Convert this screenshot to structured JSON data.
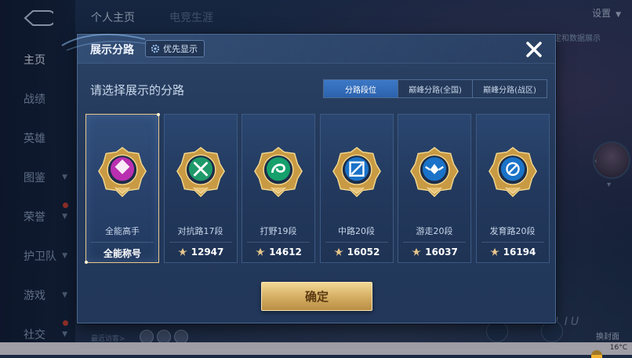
{
  "sidebar": {
    "items": [
      {
        "label": "主页",
        "active": true,
        "chevron": false,
        "dot": false
      },
      {
        "label": "战绩",
        "active": false,
        "chevron": false,
        "dot": false
      },
      {
        "label": "英雄",
        "active": false,
        "chevron": false,
        "dot": false
      },
      {
        "label": "图鉴",
        "active": false,
        "chevron": true,
        "dot": false
      },
      {
        "label": "荣誉",
        "active": false,
        "chevron": true,
        "dot": true
      },
      {
        "label": "护卫队",
        "active": false,
        "chevron": true,
        "dot": false
      },
      {
        "label": "游戏",
        "active": false,
        "chevron": true,
        "dot": false
      },
      {
        "label": "社交",
        "active": false,
        "chevron": true,
        "dot": true
      }
    ]
  },
  "header": {
    "tabs": [
      "个人主页",
      "电竞生涯"
    ],
    "settings_label": "设置",
    "right_snippet": "定和数据展示"
  },
  "background": {
    "visitors_label": "最近访客>",
    "right_edge_name": "LIU",
    "change_cover_label": "换封面",
    "temperature": "16°C"
  },
  "dialog": {
    "title": "展示分路",
    "priority_label": "优先显示",
    "subtitle": "请选择展示的分路",
    "tabs": [
      {
        "label": "分路段位",
        "active": true
      },
      {
        "label": "巅峰分路(全国)",
        "active": false
      },
      {
        "label": "巅峰分路(战区)",
        "active": false
      }
    ],
    "cards": [
      {
        "rank": "全能高手",
        "score": "全能称号",
        "selected": true,
        "show_icon": false,
        "emblem": "all-round-emblem-icon",
        "color": "#b92fb0"
      },
      {
        "rank": "对抗路17段",
        "score": "12947",
        "selected": false,
        "show_icon": true,
        "emblem": "clash-lane-emblem-icon",
        "color": "#1e9a6a"
      },
      {
        "rank": "打野19段",
        "score": "14612",
        "selected": false,
        "show_icon": true,
        "emblem": "jungle-emblem-icon",
        "color": "#15a06c"
      },
      {
        "rank": "中路20段",
        "score": "16052",
        "selected": false,
        "show_icon": true,
        "emblem": "mid-lane-emblem-icon",
        "color": "#1a73c8"
      },
      {
        "rank": "游走20段",
        "score": "16037",
        "selected": false,
        "show_icon": true,
        "emblem": "roam-emblem-icon",
        "color": "#1a73c8"
      },
      {
        "rank": "发育路20段",
        "score": "16194",
        "selected": false,
        "show_icon": true,
        "emblem": "farm-lane-emblem-icon",
        "color": "#1a73c8"
      }
    ],
    "confirm_label": "确定"
  },
  "colors": {
    "accent_gold": "#e7c78a",
    "tab_active": "#2c62ad",
    "panel_bg": "#24395a"
  }
}
